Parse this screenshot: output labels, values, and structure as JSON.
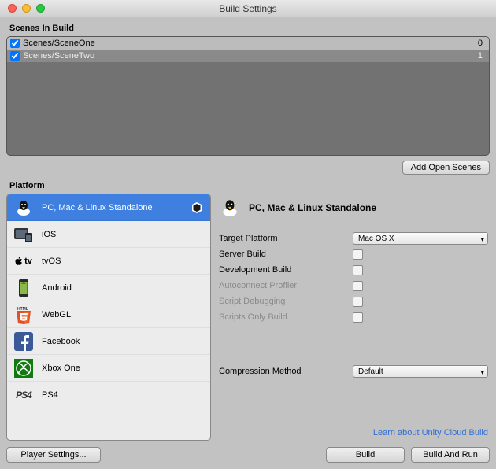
{
  "window": {
    "title": "Build Settings"
  },
  "scenes": {
    "label": "Scenes In Build",
    "items": [
      {
        "name": "Scenes/SceneOne",
        "index": "0",
        "checked": true,
        "selected": false
      },
      {
        "name": "Scenes/SceneTwo",
        "index": "1",
        "checked": true,
        "selected": true
      }
    ],
    "add_button": "Add Open Scenes"
  },
  "platform": {
    "label": "Platform",
    "items": [
      {
        "name": "PC, Mac & Linux Standalone",
        "icon": "tux-icon",
        "selected": true,
        "current_target": true
      },
      {
        "name": "iOS",
        "icon": "ios-icon",
        "selected": false,
        "current_target": false
      },
      {
        "name": "tvOS",
        "icon": "appletv-icon",
        "selected": false,
        "current_target": false
      },
      {
        "name": "Android",
        "icon": "android-icon",
        "selected": false,
        "current_target": false
      },
      {
        "name": "WebGL",
        "icon": "html5-icon",
        "selected": false,
        "current_target": false
      },
      {
        "name": "Facebook",
        "icon": "facebook-icon",
        "selected": false,
        "current_target": false
      },
      {
        "name": "Xbox One",
        "icon": "xbox-icon",
        "selected": false,
        "current_target": false
      },
      {
        "name": "PS4",
        "icon": "ps4-icon",
        "selected": false,
        "current_target": false
      }
    ]
  },
  "settings": {
    "header": "PC, Mac & Linux Standalone",
    "header_icon": "tux-icon",
    "fields": {
      "target_platform": {
        "label": "Target Platform",
        "value": "Mac OS X",
        "enabled": true,
        "type": "select"
      },
      "server_build": {
        "label": "Server Build",
        "checked": false,
        "enabled": true,
        "type": "check"
      },
      "dev_build": {
        "label": "Development Build",
        "checked": false,
        "enabled": true,
        "type": "check"
      },
      "autoconnect": {
        "label": "Autoconnect Profiler",
        "checked": false,
        "enabled": false,
        "type": "check"
      },
      "script_debug": {
        "label": "Script Debugging",
        "checked": false,
        "enabled": false,
        "type": "check"
      },
      "scripts_only": {
        "label": "Scripts Only Build",
        "checked": false,
        "enabled": false,
        "type": "check"
      },
      "compression": {
        "label": "Compression Method",
        "value": "Default",
        "enabled": true,
        "type": "select"
      }
    },
    "link": "Learn about Unity Cloud Build"
  },
  "buttons": {
    "player_settings": "Player Settings...",
    "build": "Build",
    "build_run": "Build And Run"
  }
}
